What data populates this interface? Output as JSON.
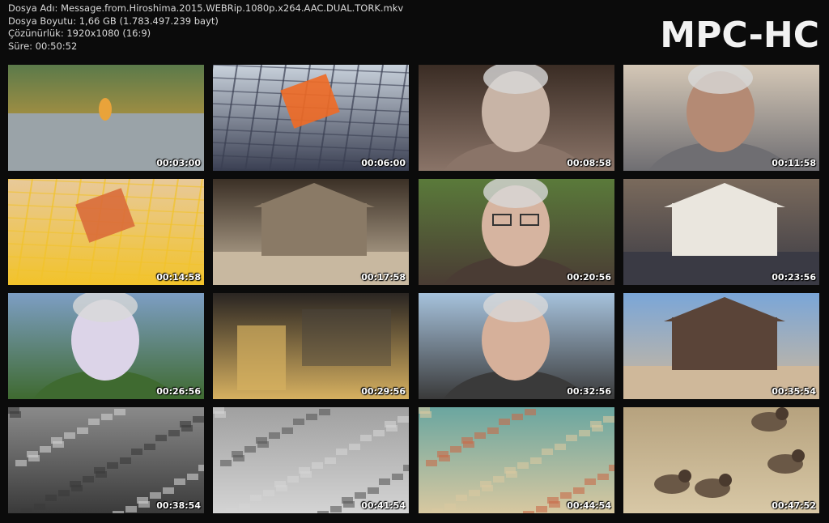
{
  "header": {
    "file_name": "Dosya Adı: Message.from.Hiroshima.2015.WEBRip.1080p.x264.AAC.DUAL.TORK.mkv",
    "file_size": "Dosya Boyutu: 1,66 GB (1.783.497.239 bayt)",
    "resolution": "Çözünürlük: 1920x1080 (16:9)",
    "duration": "Süre: 00:50:52",
    "logo": "MPC-HC"
  },
  "thumbnails": [
    {
      "time": "00:03:00",
      "scene": "memorial-flame",
      "colors": [
        "#5b7a4a",
        "#9aa3a8",
        "#e9a33a"
      ]
    },
    {
      "time": "00:06:00",
      "scene": "map-closeup",
      "colors": [
        "#c9d2dc",
        "#f06a25",
        "#3a3f52"
      ]
    },
    {
      "time": "00:08:58",
      "scene": "elderly-woman",
      "colors": [
        "#3a2c24",
        "#c8b4a6",
        "#8a7468"
      ]
    },
    {
      "time": "00:11:58",
      "scene": "elderly-man-sweater",
      "colors": [
        "#d4c7b6",
        "#b48a74",
        "#6f6e72"
      ]
    },
    {
      "time": "00:14:58",
      "scene": "old-map",
      "colors": [
        "#e8c99a",
        "#d96c3a",
        "#f2c32a"
      ]
    },
    {
      "time": "00:17:58",
      "scene": "sepia-street",
      "colors": [
        "#3b3026",
        "#8a7a66",
        "#c8b8a0"
      ]
    },
    {
      "time": "00:20:56",
      "scene": "smiling-man-glasses",
      "colors": [
        "#5a7a3a",
        "#d6b4a0",
        "#4a3c34"
      ]
    },
    {
      "time": "00:23:56",
      "scene": "old-street-sign",
      "colors": [
        "#7a6a5c",
        "#eae6de",
        "#3a3a44"
      ]
    },
    {
      "time": "00:26:56",
      "scene": "man-in-park",
      "colors": [
        "#7d9ec4",
        "#dcd4e8",
        "#3f6a30"
      ]
    },
    {
      "time": "00:29:56",
      "scene": "dark-room-poster",
      "colors": [
        "#2a2522",
        "#4a433c",
        "#d6b060"
      ]
    },
    {
      "time": "00:32:56",
      "scene": "laughing-old-man",
      "colors": [
        "#a6c2dc",
        "#d6b09a",
        "#3a3a3a"
      ]
    },
    {
      "time": "00:35:54",
      "scene": "traditional-buildings",
      "colors": [
        "#7aa6d8",
        "#5a4438",
        "#cfb89a"
      ]
    },
    {
      "time": "00:38:54",
      "scene": "ruins-bw",
      "colors": [
        "#8a8a8a",
        "#cfcfcf",
        "#3a3a3a"
      ]
    },
    {
      "time": "00:41:54",
      "scene": "aerial-bw",
      "colors": [
        "#a0a0a0",
        "#5a5a5a",
        "#d4d4d4"
      ]
    },
    {
      "time": "00:44:54",
      "scene": "color-film-ruins",
      "colors": [
        "#6aa6a0",
        "#c86a4a",
        "#d8c8a0"
      ]
    },
    {
      "time": "00:47:52",
      "scene": "sparrows",
      "colors": [
        "#b6a27e",
        "#6a5846",
        "#d8c8a6"
      ]
    }
  ]
}
